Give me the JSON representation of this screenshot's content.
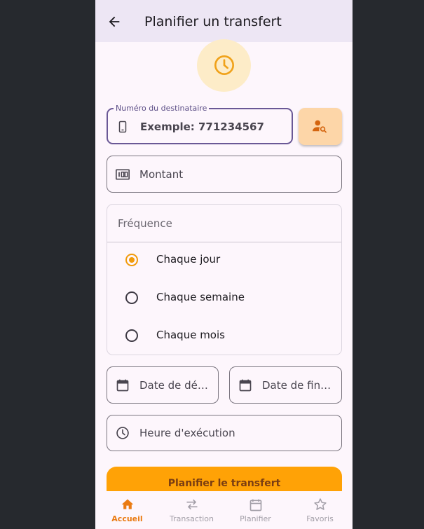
{
  "appbar": {
    "title": "Planifier un transfert"
  },
  "recipient": {
    "label": "Numéro du destinataire",
    "placeholder": "Exemple: 771234567"
  },
  "amount": {
    "placeholder": "Montant"
  },
  "frequency": {
    "label": "Fréquence",
    "options": [
      "Chaque jour",
      "Chaque semaine",
      "Chaque mois"
    ],
    "selected": "Chaque jour"
  },
  "dates": {
    "start_placeholder": "Date de dé…",
    "end_placeholder": "Date de fin…"
  },
  "time": {
    "placeholder": "Heure d'exécution"
  },
  "submit": {
    "label": "Planifier le transfert"
  },
  "bottom_nav": {
    "items": [
      {
        "label": "Accueil",
        "icon": "home-icon",
        "active": true
      },
      {
        "label": "Transaction",
        "icon": "swap-icon",
        "active": false
      },
      {
        "label": "Planifier",
        "icon": "calendar-icon",
        "active": false
      },
      {
        "label": "Favoris",
        "icon": "star-icon",
        "active": false
      }
    ]
  },
  "colors": {
    "accent": "#ffa206",
    "primary": "#6a5896",
    "appbar_bg": "#ede6f4",
    "page_bg": "#fdf6fc"
  }
}
